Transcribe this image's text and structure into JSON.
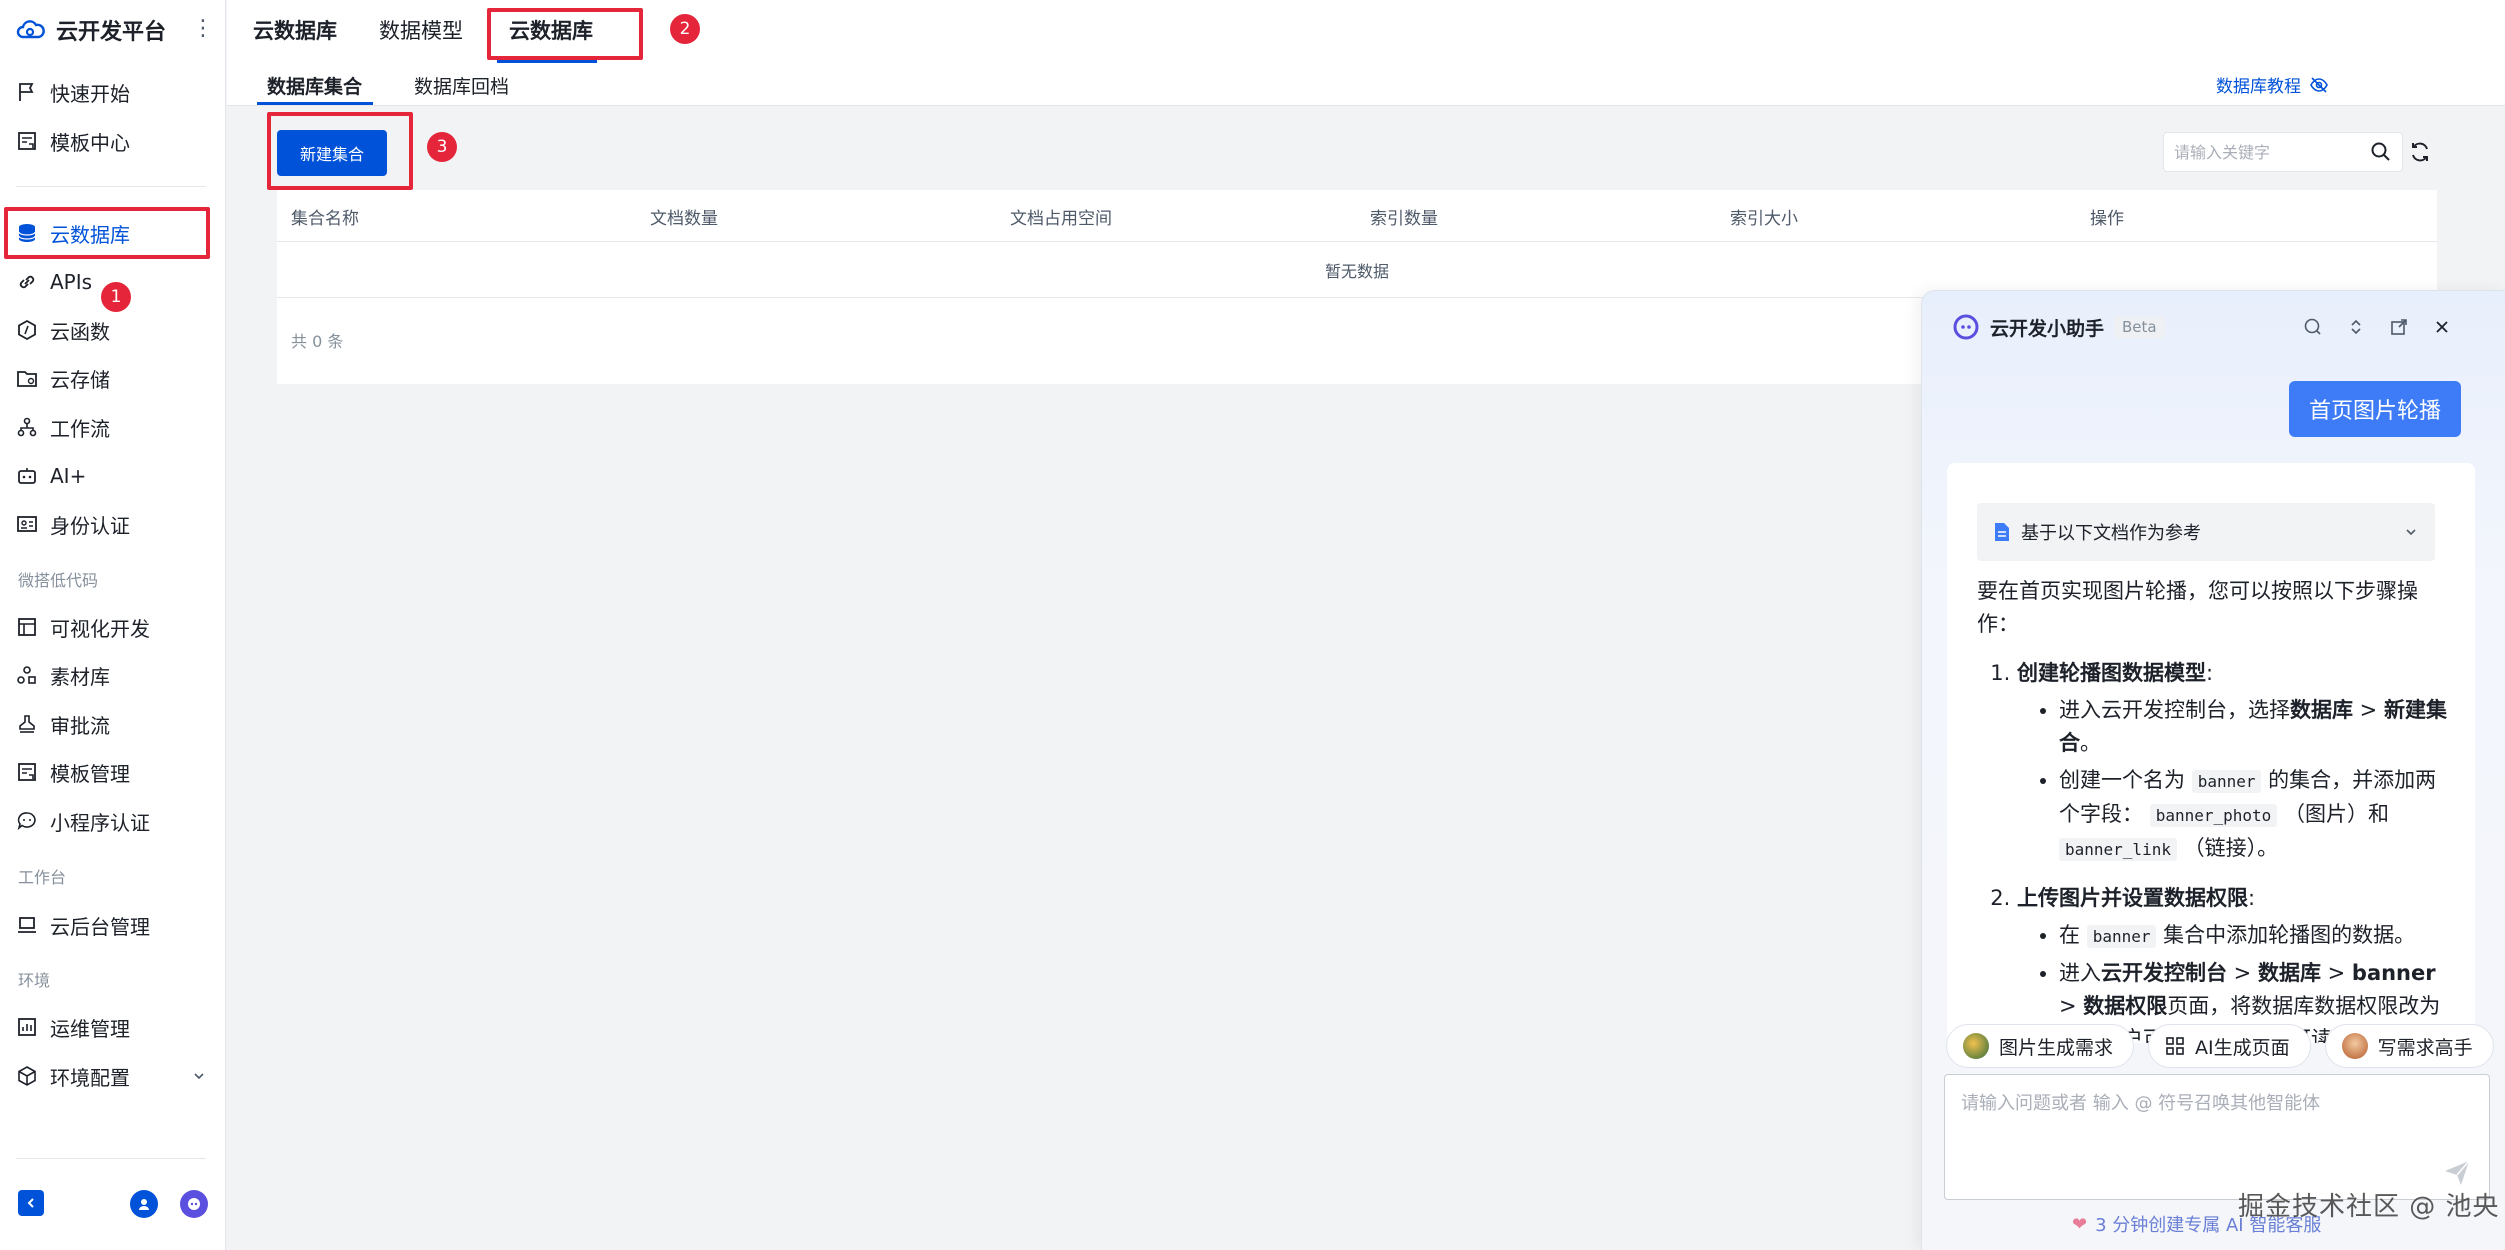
{
  "sidebar": {
    "brand": "云开发平台",
    "items": [
      {
        "label": "快速开始",
        "icon": "flag-icon"
      },
      {
        "label": "模板中心",
        "icon": "template-icon"
      },
      {
        "label": "云数据库",
        "icon": "database-icon"
      },
      {
        "label": "APIs",
        "icon": "link-icon"
      },
      {
        "label": "云函数",
        "icon": "function-icon"
      },
      {
        "label": "云存储",
        "icon": "folder-icon"
      },
      {
        "label": "工作流",
        "icon": "workflow-icon"
      },
      {
        "label": "AI+",
        "icon": "robot-icon"
      },
      {
        "label": "身份认证",
        "icon": "id-card-icon"
      },
      {
        "label": "可视化开发",
        "icon": "layout-icon"
      },
      {
        "label": "素材库",
        "icon": "assets-icon"
      },
      {
        "label": "审批流",
        "icon": "stamp-icon"
      },
      {
        "label": "模板管理",
        "icon": "template-manage-icon"
      },
      {
        "label": "小程序认证",
        "icon": "miniprogram-icon"
      },
      {
        "label": "云后台管理",
        "icon": "laptop-icon"
      },
      {
        "label": "运维管理",
        "icon": "chart-icon"
      },
      {
        "label": "环境配置",
        "icon": "cube-icon"
      }
    ],
    "sections": {
      "lowcode": "微搭低代码",
      "workbench": "工作台",
      "env": "环境"
    }
  },
  "annotations": {
    "one": "1",
    "two": "2",
    "three": "3"
  },
  "topbar": {
    "section_title": "云数据库",
    "tabs": [
      "数据模型",
      "云数据库"
    ],
    "subtabs": [
      "数据库集合",
      "数据库回档"
    ],
    "tutorial_link": "数据库教程"
  },
  "content": {
    "new_button": "新建集合",
    "search_placeholder": "请输入关键字",
    "columns": [
      "集合名称",
      "文档数量",
      "文档占用空间",
      "索引数量",
      "索引大小",
      "操作"
    ],
    "empty_text": "暂无数据",
    "total": "共 0 条"
  },
  "assistant": {
    "title": "云开发小助手",
    "beta": "Beta",
    "user_message": "首页图片轮播",
    "reference": "基于以下文档作为参考",
    "intro": "要在首页实现图片轮播，您可以按照以下步骤操作：",
    "step1_title": "创建轮播图数据模型",
    "step1_b1_pre": "进入云开发控制台，选择",
    "step1_b1_db": "数据库",
    "step1_b1_sep": " > ",
    "step1_b1_new": "新建集合",
    "step1_b1_end": "。",
    "step1_b2_pre": "创建一个名为",
    "step1_b2_code1": "banner",
    "step1_b2_mid": "的集合，并添加两个字段：",
    "step1_b2_code2": "banner_photo",
    "step1_b2_mid2": "（图片）和",
    "step1_b2_code3": "banner_link",
    "step1_b2_end": "（链接）。",
    "step2_title": "上传图片并设置数据权限",
    "step2_b1_pre": "在",
    "step2_b1_code": "banner",
    "step2_b1_end": "集合中添加轮播图的数据。",
    "step2_b2_pre": "进入",
    "step2_b2_console": "云开发控制台",
    "step2_b2_sep1": " > ",
    "step2_b2_db": "数据库",
    "step2_b2_sep2": " > ",
    "step2_b2_banner": "banner",
    "step2_b2_sep3": " > ",
    "step2_b2_perm": "数据权限",
    "step2_b2_end": "页面，将数据库数据权限改为所有用户可读，仅创建者可读写。",
    "chips": [
      "图片生成需求",
      "AI生成页面",
      "写需求高手"
    ],
    "input_placeholder": "请输入问题或者 输入 @ 符号召唤其他智能体",
    "footnote": "3 分钟创建专属 AI 智能客服"
  },
  "watermark": "掘金技术社区 @ 池央",
  "colors": {
    "accent": "#0052d9",
    "annotation": "#e5263a",
    "assistant_bubble": "#3e7bf6"
  }
}
